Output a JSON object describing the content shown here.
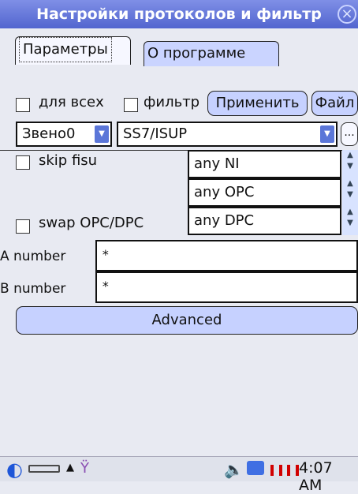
{
  "window": {
    "title": "Настройки протоколов и фильтр"
  },
  "tabs": [
    {
      "label": "Параметры",
      "active": true
    },
    {
      "label": "О программе",
      "active": false
    }
  ],
  "toolbar": {
    "all_label": "для всех",
    "filter_label": "фильтр",
    "apply_button": "Применить",
    "file_button": "Файл"
  },
  "selectors": {
    "link": "Звено0",
    "protocol": "SS7/ISUP",
    "more_button": "..."
  },
  "options": {
    "skip_fisu": "skip fisu",
    "swap_opc_dpc": "swap OPC/DPC",
    "ni": "any NI",
    "opc": "any OPC",
    "dpc": "any DPC"
  },
  "numbers": {
    "a_label": "A number",
    "a_value": "*",
    "b_label": "B number",
    "b_value": "*"
  },
  "advanced_button": "Advanced",
  "taskbar": {
    "time": "4:07 AM",
    "icons": [
      "start-icon",
      "keyboard-icon",
      "up-arrow-icon",
      "antenna-icon",
      "speaker-icon",
      "network-icon",
      "battery-icon"
    ]
  }
}
